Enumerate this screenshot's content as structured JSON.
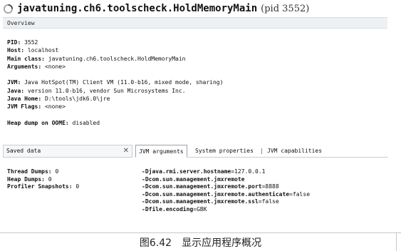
{
  "header": {
    "main_class": "javatuning.ch6.toolscheck.HoldMemoryMain",
    "pid_text": "(pid 3552)"
  },
  "overview": {
    "label": "Overview"
  },
  "info": [
    {
      "label": "PID:",
      "value": " 3552"
    },
    {
      "label": "Host:",
      "value": " localhost"
    },
    {
      "label": "Main class:",
      "value": " javatuning.ch6.toolscheck.HoldMemoryMain"
    },
    {
      "label": "Arguments:",
      "value": " <none>"
    },
    {
      "label": "",
      "value": ""
    },
    {
      "label": "JVM:",
      "value": " Java HotSpot(TM) Client VM (11.0-b16, mixed mode, sharing)"
    },
    {
      "label": "Java:",
      "value": " version 11.0-b16, vendor Sun Microsystems Inc."
    },
    {
      "label": "Java Home:",
      "value": " D:\\tools\\jdk6.0\\jre"
    },
    {
      "label": "JVM Flags:",
      "value": " <none>"
    },
    {
      "label": "",
      "value": ""
    },
    {
      "label": "Heap dump on OOME:",
      "value": " disabled"
    }
  ],
  "saved_data": {
    "title": "Saved data",
    "close": "✕",
    "rows": [
      {
        "label": "Thread Dumps:",
        "value": " 0"
      },
      {
        "label": "Heap Dumps:",
        "value": " 0"
      },
      {
        "label": "Profiler Snapshots:",
        "value": " 0"
      }
    ]
  },
  "tabs": {
    "jvm_arguments": "JVM arguments",
    "system_properties": "System properties",
    "separator": "|",
    "jvm_capabilities": "JVM capabilities"
  },
  "jvm_args": [
    {
      "key": "-Djava.rmi.server.hostname",
      "val": "=127.0.0.1"
    },
    {
      "key": "-Dcom.sun.management.jmxremote",
      "val": ""
    },
    {
      "key": "-Dcom.sun.management.jmxremote.port",
      "val": "=8888"
    },
    {
      "key": "-Dcom.sun.management.jmxremote.authenticate",
      "val": "=false"
    },
    {
      "key": "-Dcom.sun.management.jmxremote.ssl",
      "val": "=false"
    },
    {
      "key": "-Dfile.encoding",
      "val": "=GBK"
    }
  ],
  "caption": {
    "text": "图6.42　显示应用程序概况"
  }
}
